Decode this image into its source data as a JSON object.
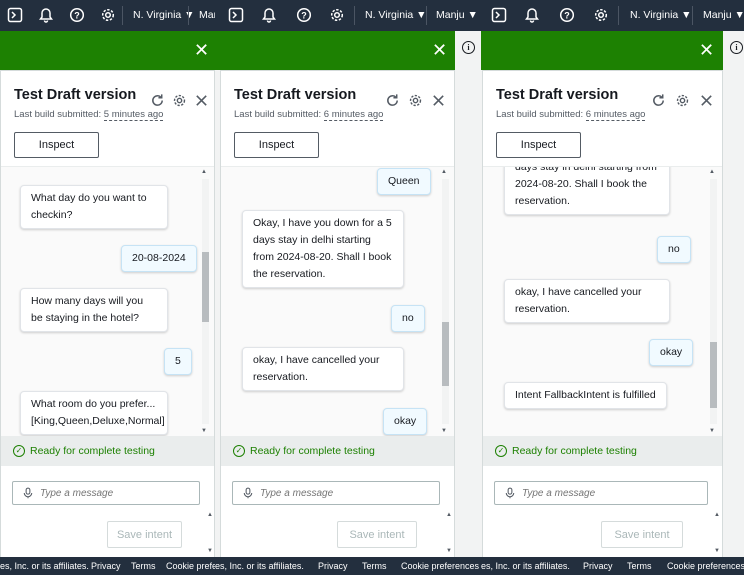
{
  "topbar": {
    "region": "N. Virginia ▼",
    "user_full": "Manju ▼",
    "user_clipped": "Manj"
  },
  "panel": {
    "title": "Test Draft version",
    "submitted_label": "Last build submitted:",
    "inspect_label": "Inspect",
    "status_text": "Ready for complete testing",
    "message_placeholder": "Type a message",
    "save_intent_label": "Save intent"
  },
  "panes": [
    {
      "ago": "5 minutes ago",
      "messages": [
        {
          "from": "bot",
          "text": "What day do you want to checkin?"
        },
        {
          "from": "user",
          "text": "20-08-2024"
        },
        {
          "from": "bot",
          "text": "How many days will you be staying in the hotel?"
        },
        {
          "from": "user",
          "text": "5"
        },
        {
          "from": "bot",
          "text": "What room do you prefer... [King,Queen,Deluxe,Normal]"
        }
      ]
    },
    {
      "ago": "6 minutes ago",
      "messages": [
        {
          "from": "user",
          "text": "Queen"
        },
        {
          "from": "bot",
          "text": "Okay, I have you down for a 5 days stay in delhi starting from 2024-08-20. Shall I book the reservation."
        },
        {
          "from": "user",
          "text": "no"
        },
        {
          "from": "bot",
          "text": "okay, I have cancelled your reservation."
        },
        {
          "from": "user",
          "text": "okay"
        }
      ]
    },
    {
      "ago": "6 minutes ago",
      "messages": [
        {
          "from": "bot",
          "text": "days stay in delhi starting from 2024-08-20. Shall I book the reservation."
        },
        {
          "from": "user",
          "text": "no"
        },
        {
          "from": "bot",
          "text": "okay, I have cancelled your reservation."
        },
        {
          "from": "user",
          "text": "okay"
        },
        {
          "from": "bot",
          "text": "Intent FallbackIntent is fulfilled"
        }
      ]
    }
  ],
  "footer": {
    "copyright_fragment": "es, Inc. or its affiliates.",
    "privacy": "Privacy",
    "terms": "Terms",
    "cookie_clipped": "Cookie prefere",
    "cookie": "Cookie preferences"
  },
  "colors": {
    "nav": "#232f3e",
    "banner": "#1d8102",
    "status": "#1d8102",
    "user_bubble": "#f1faff"
  }
}
